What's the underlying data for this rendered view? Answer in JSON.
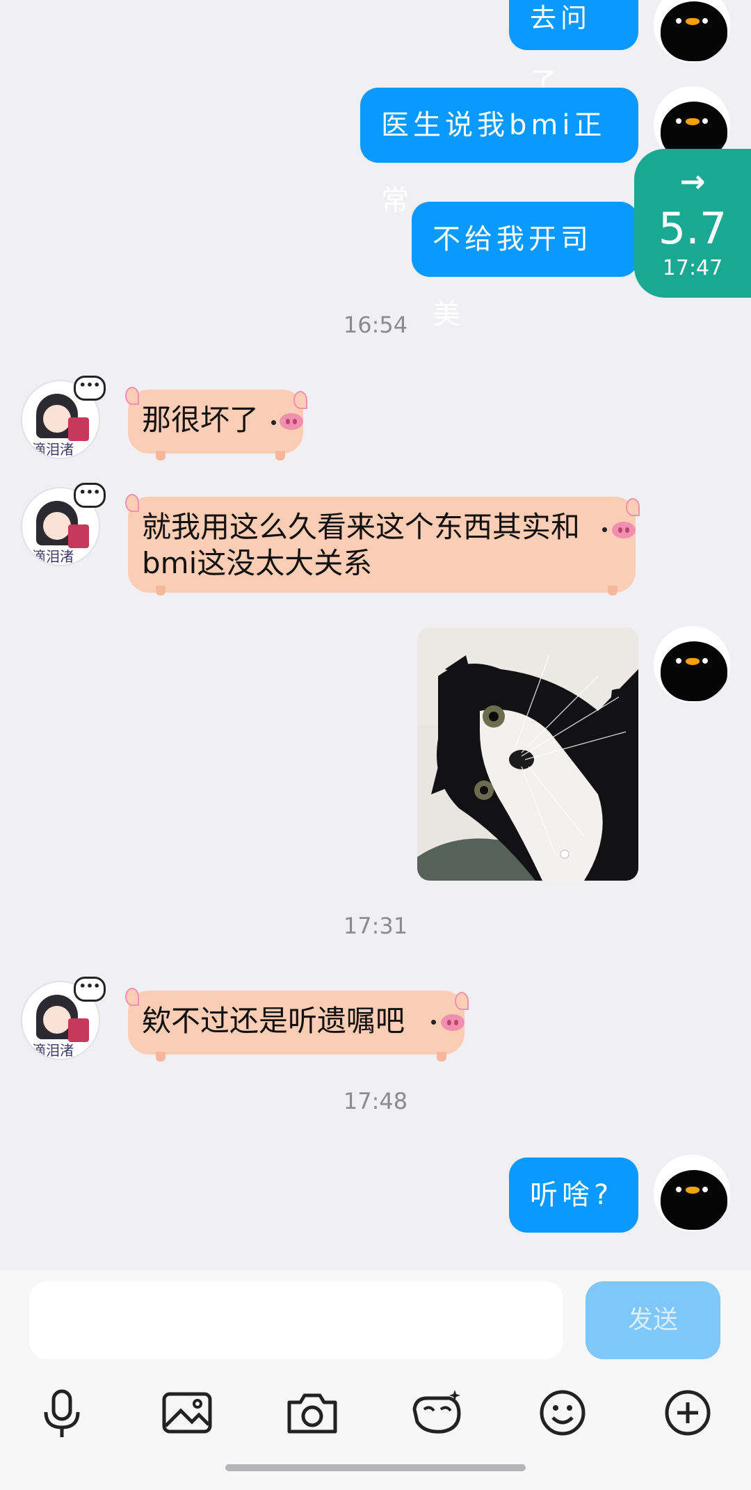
{
  "messages": [
    {
      "side": "me",
      "text": "去问了"
    },
    {
      "side": "me",
      "text": "医生说我bmi正常"
    },
    {
      "side": "me",
      "text": "不给我开司美"
    },
    {
      "type": "time",
      "text": "16:54"
    },
    {
      "side": "friend",
      "text": "那很坏了"
    },
    {
      "side": "friend",
      "text": "就我用这么久看来这个东西其实和bmi这没太大关系"
    },
    {
      "side": "me",
      "type": "image",
      "image_icon": "cat-photo"
    },
    {
      "type": "time",
      "text": "17:31"
    },
    {
      "side": "friend",
      "text": "欸不过还是听遗嘱吧"
    },
    {
      "type": "time",
      "text": "17:48"
    },
    {
      "side": "me",
      "text": "听啥?"
    }
  ],
  "friend": {
    "avatar_name": "滴泪渚",
    "status_icon": "more-dots-icon"
  },
  "badge": {
    "arrow": "→",
    "value": "5.7",
    "time": "17:47",
    "color": "#19a892"
  },
  "composer": {
    "send_label": "发送",
    "placeholder": ""
  },
  "toolbar": {
    "icons": [
      "microphone-icon",
      "image-icon",
      "camera-icon",
      "sticker-icon",
      "emoji-icon",
      "plus-icon"
    ]
  },
  "colors": {
    "my_bubble": "#0a99ff",
    "friend_bubble": "#fccdb5",
    "background": "#efeff4",
    "send_button": "#7fc6f9"
  }
}
